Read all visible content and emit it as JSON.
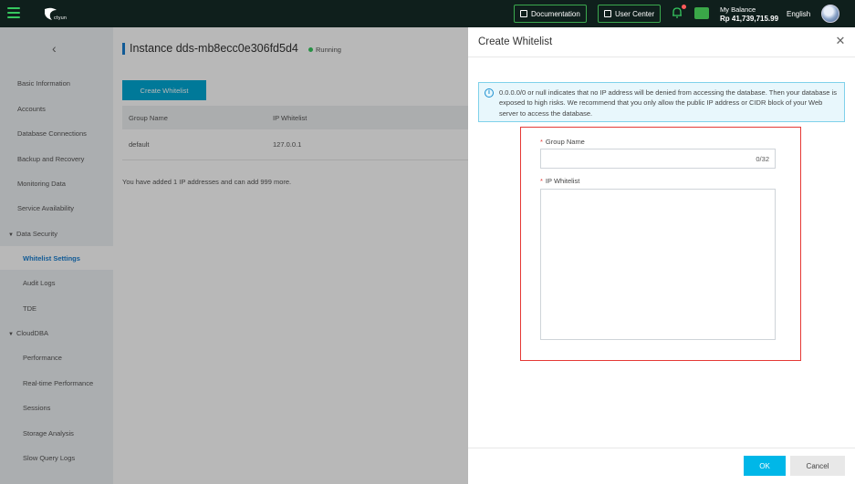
{
  "topbar": {
    "logo_text": "ctyun",
    "documentation": "Documentation",
    "user_center": "User Center",
    "balance_label": "My Balance",
    "balance_value": "Rp 41,739,715.99",
    "language": "English"
  },
  "sidebar": {
    "items": [
      {
        "label": "Basic Information"
      },
      {
        "label": "Accounts"
      },
      {
        "label": "Database Connections"
      },
      {
        "label": "Backup and Recovery"
      },
      {
        "label": "Monitoring Data"
      },
      {
        "label": "Service Availability"
      },
      {
        "label": "Data Security"
      },
      {
        "label": "Whitelist Settings"
      },
      {
        "label": "Audit Logs"
      },
      {
        "label": "TDE"
      },
      {
        "label": "CloudDBA"
      },
      {
        "label": "Performance"
      },
      {
        "label": "Real-time Performance"
      },
      {
        "label": "Sessions"
      },
      {
        "label": "Storage Analysis"
      },
      {
        "label": "Slow Query Logs"
      }
    ]
  },
  "main": {
    "title": "Instance dds-mb8ecc0e306fd5d4",
    "status": "Running",
    "create_button": "Create Whitelist",
    "table": {
      "headers": [
        "Group Name",
        "IP Whitelist"
      ],
      "rows": [
        [
          "default",
          "127.0.0.1"
        ]
      ]
    },
    "added_note": "You have added 1 IP addresses and can add 999 more."
  },
  "drawer": {
    "title": "Create Whitelist",
    "info": "0.0.0.0/0 or null indicates that no IP address will be denied from accessing the database. Then your database is exposed to high risks. We recommend that you only allow the public IP address or CIDR block of your Web server to access the database.",
    "group_name_label": "Group Name",
    "group_name_count": "0/32",
    "ip_whitelist_label": "IP Whitelist",
    "required_mark": "*",
    "ok": "OK",
    "cancel": "Cancel"
  },
  "colors": {
    "accent": "#00a8d4",
    "topbar": "#0f1f1c",
    "highlight_frame": "#e53935"
  }
}
